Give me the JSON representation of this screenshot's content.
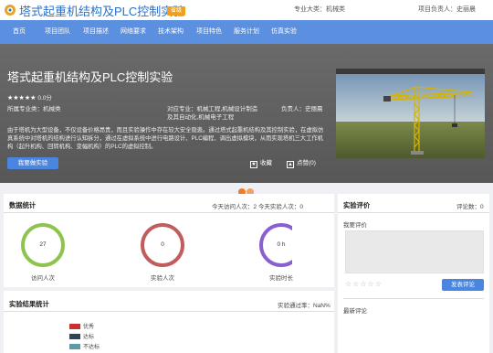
{
  "header": {
    "title": "塔式起重机结构及PLC控制实验",
    "badge": "省级",
    "major_category": "专业大类：机械类",
    "project_leader": "项目负责人：史丽晨"
  },
  "nav": {
    "items": [
      {
        "label": "首页"
      },
      {
        "label": "项目团队"
      },
      {
        "label": "项目描述"
      },
      {
        "label": "网络要求"
      },
      {
        "label": "技术架构"
      },
      {
        "label": "项目特色"
      },
      {
        "label": "服务计划"
      },
      {
        "label": "仿真实验"
      }
    ]
  },
  "hero": {
    "title": "塔式起重机结构及PLC控制实验",
    "rating_stars": "★★★★★",
    "score": "0.0分",
    "major": "所属专业类：机械类",
    "target_majors": "对应专业：机械工程,机械设计制造及其自动化,机械电子工程",
    "leader": "负责人：史丽晨",
    "description": "由于塔机为大型设备，不仅设备价格昂贵，而且实验操作中存在较大安全隐患。通过塔式起重机结构及其控制实验，在虚拟仿真系统中对塔机的结构进行认知拆分，通过在虚拟系统中进行电路设计、PLC编程、调出虚拟模块，从而实现塔机三大工作机构（起升机构、回转机构、变幅机构）的PLC的虚拟控制。",
    "apply_button": "我要做实验",
    "favorite_label": "收藏",
    "like_label": "点赞(0)"
  },
  "stats": {
    "title": "数据统计",
    "summary": "今天访问人次：2 今天实验人次：0",
    "rings": [
      {
        "value": "27",
        "label": "访问人次",
        "color": "#8fc34f"
      },
      {
        "value": "0",
        "label": "实验人次",
        "color": "#c05d5d"
      },
      {
        "value": "0 h",
        "label": "实验时长",
        "color": "#8a5fd0"
      }
    ]
  },
  "results": {
    "title": "实验结果统计",
    "pass_rate": "实验通过率：NaN%",
    "legend": [
      {
        "label": "优秀",
        "color": "#c8322e"
      },
      {
        "label": "达标",
        "color": "#2f4455"
      },
      {
        "label": "不达标",
        "color": "#5c9aa6"
      }
    ]
  },
  "review": {
    "title": "实验评价",
    "count": "评论数：0",
    "my_review_label": "我要评价",
    "empty_stars": "☆☆☆☆☆",
    "submit_button": "发表评论",
    "latest_label": "最新评论"
  },
  "colors": {
    "accent": "#5b8fe0",
    "button": "#4a86e0",
    "badge": "#f0a020",
    "title": "#2e6fc2"
  }
}
